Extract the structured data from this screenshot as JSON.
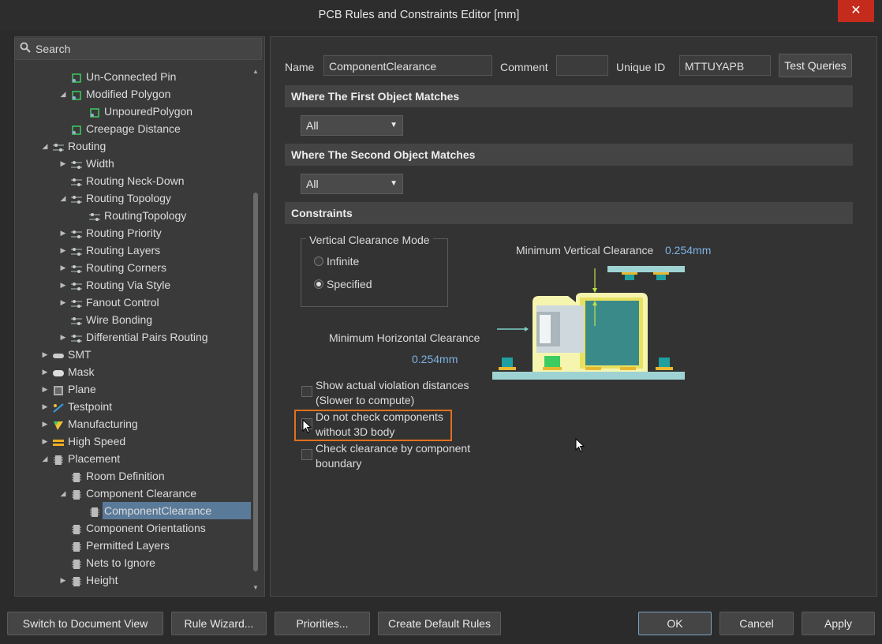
{
  "window": {
    "title": "PCB Rules and Constraints Editor [mm]",
    "close": "✕"
  },
  "search": {
    "placeholder": "Search"
  },
  "tree": [
    {
      "indent": 3,
      "arrow": "",
      "icon": "polygon-rule-icon",
      "label": "Un-Connected Pin"
    },
    {
      "indent": 3,
      "arrow": "open",
      "icon": "polygon-rule-icon",
      "label": "Modified Polygon"
    },
    {
      "indent": 4,
      "arrow": "",
      "icon": "polygon-rule-icon",
      "label": "UnpouredPolygon"
    },
    {
      "indent": 3,
      "arrow": "",
      "icon": "polygon-rule-icon",
      "label": "Creepage Distance"
    },
    {
      "indent": 2,
      "arrow": "open",
      "icon": "routing-icon",
      "label": "Routing"
    },
    {
      "indent": 3,
      "arrow": "closed",
      "icon": "routing-icon",
      "label": "Width"
    },
    {
      "indent": 3,
      "arrow": "",
      "icon": "routing-icon",
      "label": "Routing Neck-Down"
    },
    {
      "indent": 3,
      "arrow": "open",
      "icon": "routing-icon",
      "label": "Routing Topology"
    },
    {
      "indent": 4,
      "arrow": "",
      "icon": "routing-icon",
      "label": "RoutingTopology"
    },
    {
      "indent": 3,
      "arrow": "closed",
      "icon": "routing-icon",
      "label": "Routing Priority"
    },
    {
      "indent": 3,
      "arrow": "closed",
      "icon": "routing-icon",
      "label": "Routing Layers"
    },
    {
      "indent": 3,
      "arrow": "closed",
      "icon": "routing-icon",
      "label": "Routing Corners"
    },
    {
      "indent": 3,
      "arrow": "closed",
      "icon": "routing-icon",
      "label": "Routing Via Style"
    },
    {
      "indent": 3,
      "arrow": "closed",
      "icon": "routing-icon",
      "label": "Fanout Control"
    },
    {
      "indent": 3,
      "arrow": "",
      "icon": "routing-icon",
      "label": "Wire Bonding"
    },
    {
      "indent": 3,
      "arrow": "closed",
      "icon": "routing-icon",
      "label": "Differential Pairs Routing"
    },
    {
      "indent": 2,
      "arrow": "closed",
      "icon": "smt-icon",
      "label": "SMT"
    },
    {
      "indent": 2,
      "arrow": "closed",
      "icon": "mask-icon",
      "label": "Mask"
    },
    {
      "indent": 2,
      "arrow": "closed",
      "icon": "plane-icon",
      "label": "Plane"
    },
    {
      "indent": 2,
      "arrow": "closed",
      "icon": "testpoint-icon",
      "label": "Testpoint"
    },
    {
      "indent": 2,
      "arrow": "closed",
      "icon": "manufacturing-icon",
      "label": "Manufacturing"
    },
    {
      "indent": 2,
      "arrow": "closed",
      "icon": "high-speed-icon",
      "label": "High Speed"
    },
    {
      "indent": 2,
      "arrow": "open",
      "icon": "placement-icon",
      "label": "Placement"
    },
    {
      "indent": 3,
      "arrow": "",
      "icon": "placement-icon",
      "label": "Room Definition"
    },
    {
      "indent": 3,
      "arrow": "open",
      "icon": "placement-icon",
      "label": "Component Clearance"
    },
    {
      "indent": 4,
      "arrow": "",
      "icon": "placement-icon",
      "label": "ComponentClearance",
      "selected": true
    },
    {
      "indent": 3,
      "arrow": "",
      "icon": "placement-icon",
      "label": "Component Orientations"
    },
    {
      "indent": 3,
      "arrow": "",
      "icon": "placement-icon",
      "label": "Permitted Layers"
    },
    {
      "indent": 3,
      "arrow": "",
      "icon": "placement-icon",
      "label": "Nets to Ignore"
    },
    {
      "indent": 3,
      "arrow": "closed",
      "icon": "placement-icon",
      "label": "Height"
    }
  ],
  "rule": {
    "name_label": "Name",
    "name_value": "ComponentClearance",
    "comment_label": "Comment",
    "comment_value": "",
    "uid_label": "Unique ID",
    "uid_value": "MTTUYAPB",
    "test_queries": "Test Queries"
  },
  "first_match": {
    "title": "Where The First Object Matches",
    "value": "All"
  },
  "second_match": {
    "title": "Where The Second Object Matches",
    "value": "All"
  },
  "constraints": {
    "title": "Constraints",
    "mode_group": "Vertical Clearance Mode",
    "infinite": "Infinite",
    "specified": "Specified",
    "min_vertical_label": "Minimum Vertical Clearance",
    "min_vertical_value": "0.254mm",
    "min_horizontal_label": "Minimum Horizontal Clearance",
    "min_horizontal_value": "0.254mm",
    "cb1_line1": "Show actual violation distances",
    "cb1_line2": "(Slower to compute)",
    "cb2_line1": "Do not check components",
    "cb2_line2": "without 3D body",
    "cb3_line1": "Check clearance by component",
    "cb3_line2": "boundary"
  },
  "footer": {
    "switch_view": "Switch to Document View",
    "rule_wizard": "Rule Wizard...",
    "priorities": "Priorities...",
    "create_default": "Create Default Rules",
    "ok": "OK",
    "cancel": "Cancel",
    "apply": "Apply"
  },
  "colors": {
    "accent_orange": "#e07020",
    "selection": "#5a7a99",
    "value_blue": "#7fb2e5"
  }
}
